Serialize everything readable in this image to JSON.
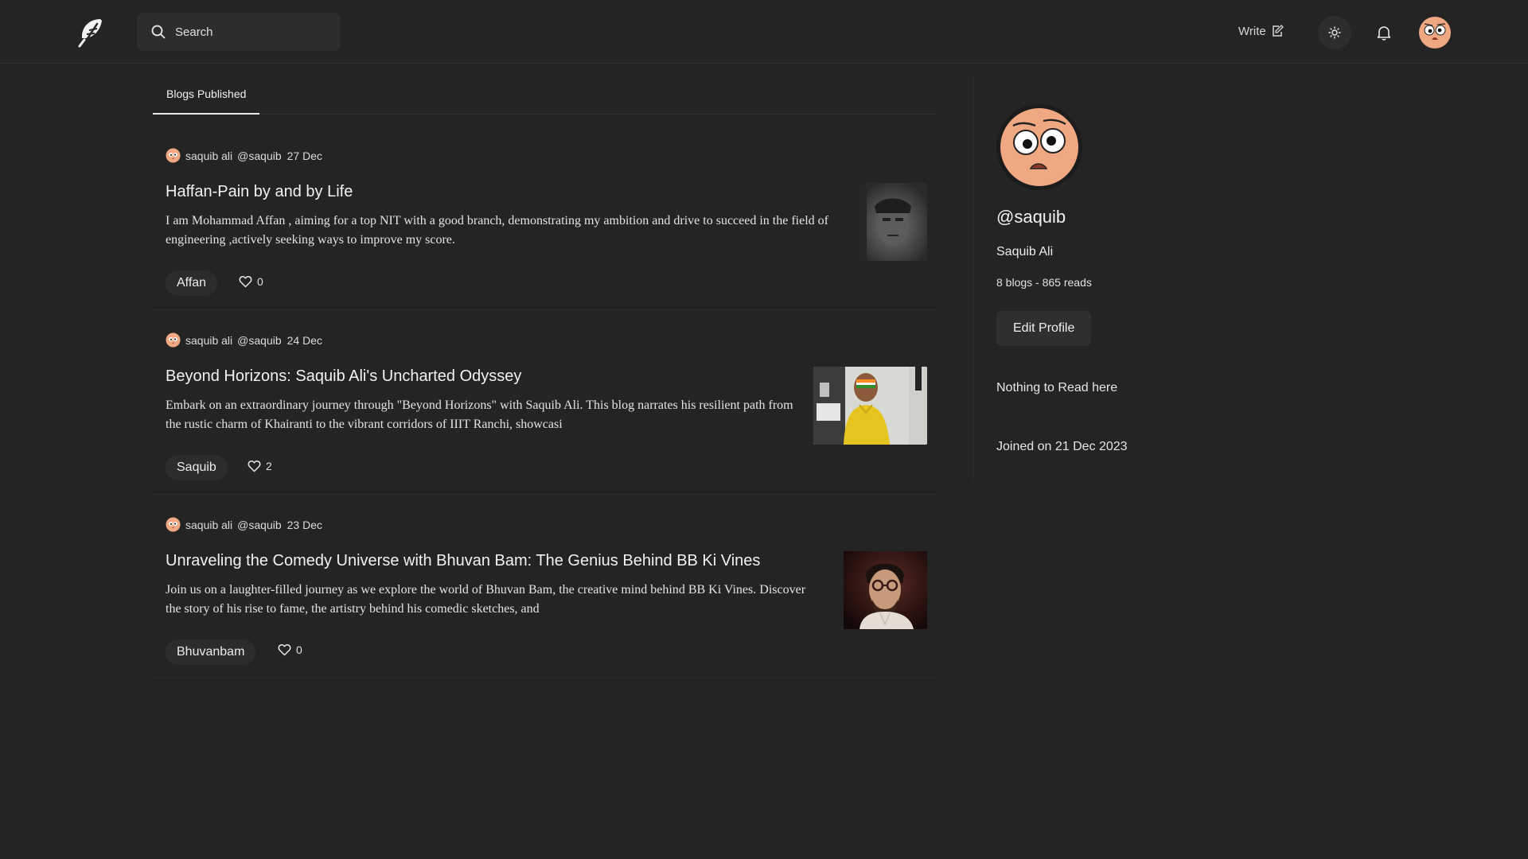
{
  "header": {
    "search_placeholder": "Search",
    "write_label": "Write",
    "icons": {
      "logo": "feather-icon",
      "search": "search-icon",
      "write": "edit-icon",
      "theme": "sun-icon",
      "notifications": "bell-icon",
      "avatar": "user-avatar"
    }
  },
  "tabs": [
    {
      "label": "Blogs Published",
      "active": true
    }
  ],
  "posts": [
    {
      "author": "saquib ali",
      "handle": "@saquib",
      "date": "27 Dec",
      "title": "Haffan-Pain by and by Life",
      "excerpt": "I am Mohammad Affan , aiming for a top NIT with a good branch, demonstrating my ambition and drive to succeed in the field of engineering ,actively seeking ways to improve my score.",
      "tag": "Affan",
      "likes": "0"
    },
    {
      "author": "saquib ali",
      "handle": "@saquib",
      "date": "24 Dec",
      "title": "Beyond Horizons: Saquib Ali's Uncharted Odyssey",
      "excerpt": "Embark on an extraordinary journey through \"Beyond Horizons\" with Saquib Ali. This blog narrates his resilient path from the rustic charm of Khairanti to the vibrant corridors of IIIT Ranchi, showcasi",
      "tag": "Saquib",
      "likes": "2"
    },
    {
      "author": "saquib ali",
      "handle": "@saquib",
      "date": "23 Dec",
      "title": "Unraveling the Comedy Universe with Bhuvan Bam: The Genius Behind BB Ki Vines",
      "excerpt": "Join us on a laughter-filled journey as we explore the world of Bhuvan Bam, the creative mind behind BB Ki Vines. Discover the story of his rise to fame, the artistry behind his comedic sketches, and",
      "tag": "Bhuvanbam",
      "likes": "0"
    }
  ],
  "profile": {
    "handle": "@saquib",
    "name": "Saquib Ali",
    "stats": "8 blogs - 865 reads",
    "edit_label": "Edit Profile",
    "empty_message": "Nothing to Read here",
    "joined": "Joined on 21 Dec 2023"
  },
  "colors": {
    "background": "#242424",
    "surface": "#2d2d2d",
    "text": "#e8e8e8",
    "avatar_skin": "#f0a883"
  }
}
